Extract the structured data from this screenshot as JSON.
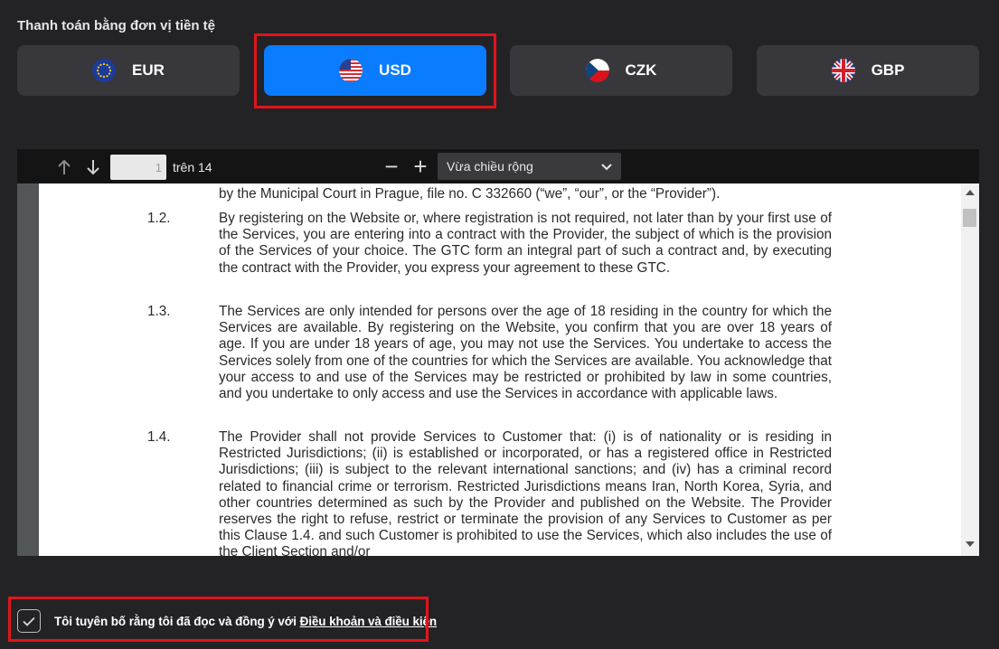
{
  "payment": {
    "label": "Thanh toán bằng đơn vị tiền tệ",
    "currencies": [
      {
        "code": "EUR",
        "icon": "eu-flag-icon",
        "selected": false
      },
      {
        "code": "USD",
        "icon": "us-flag-icon",
        "selected": true
      },
      {
        "code": "CZK",
        "icon": "cz-flag-icon",
        "selected": false
      },
      {
        "code": "GBP",
        "icon": "gb-flag-icon",
        "selected": false
      }
    ],
    "active_color": "#0a7cff",
    "highlight_color": "#e1141c"
  },
  "pdf_viewer": {
    "toolbar": {
      "prev_page_icon": "arrow-up-icon",
      "next_page_icon": "arrow-down-icon",
      "current_page": "1",
      "total_label": "trên 14",
      "zoom_out": "−",
      "zoom_in": "+",
      "zoom_mode": "Vừa chiều rộng"
    },
    "content": {
      "intro_line": "by the Municipal Court in Prague, file no. C 332660 (“we”, “our”, or the “Provider”).",
      "clauses": [
        {
          "number": "1.2.",
          "text": "By registering on the Website or, where registration is not required, not later than by your first use of the Services, you are entering into a contract with the Provider, the subject of which is the provision of the Services of your choice. The GTC  form an integral part of such a contract and, by executing the contract with the Provider, you express your agreement to these GTC."
        },
        {
          "number": "1.3.",
          "text": "The Services are only intended for persons over the age of 18 residing in the country for which the Services are available. By registering on the Website, you confirm that you are over 18 years of age. If you are under 18 years of age, you may not use the Services. You undertake to access the Services solely from one of the countries for which the Services are available. You acknowledge that your access to and use of the Services may be restricted or prohibited by law in some countries, and you undertake to only access and use the Services in accordance with applicable laws."
        },
        {
          "number": "1.4.",
          "text": "The Provider shall not provide Services to Customer that: (i) is of nationality or is residing in Restricted Jurisdictions; (ii) is established or incorporated, or has a registered office in Restricted Jurisdictions; (iii) is subject to the relevant international sanctions; and (iv) has a criminal record related to financial crime or terrorism. Restricted Jurisdictions means Iran, North Korea, Syria, and other countries determined as such by the Provider and published on the Website. The Provider reserves the right to refuse, restrict or terminate the provision of any Services to Customer as per this Clause 1.4. and such Customer is prohibited to use the Services, which also includes the use of the Client Section and/or"
        }
      ]
    }
  },
  "consent": {
    "checked": true,
    "text": "Tôi tuyên bố rằng tôi đã đọc và đồng ý với",
    "link_text": "Điều khoản và điều kiện"
  }
}
